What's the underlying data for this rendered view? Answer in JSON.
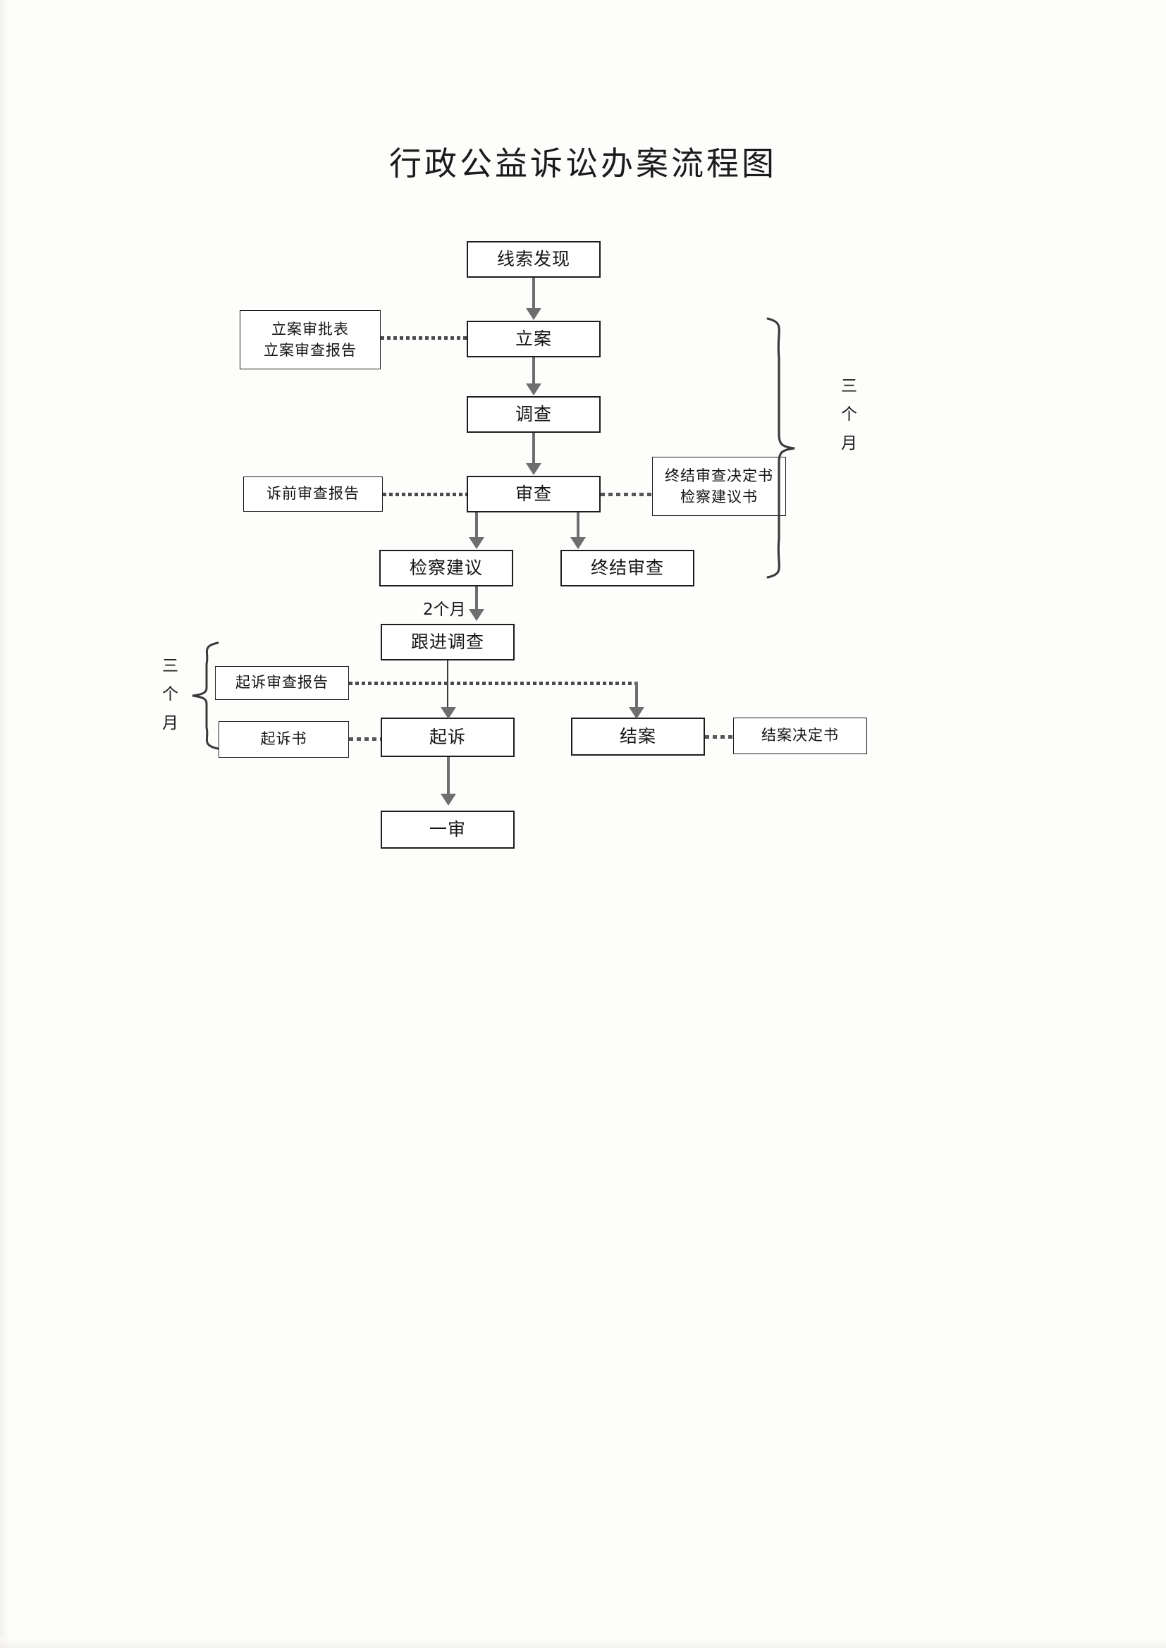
{
  "document": {
    "title": "行政公益诉讼办案流程图",
    "type": "flowchart",
    "language": "zh-CN"
  },
  "nodes": {
    "clue_discovery": {
      "label": "线索发现",
      "kind": "process"
    },
    "case_filing": {
      "label": "立案",
      "kind": "process"
    },
    "filing_docs": {
      "line1": "立案审批表",
      "line2": "立案审查报告",
      "kind": "document"
    },
    "investigation": {
      "label": "调查",
      "kind": "process"
    },
    "review": {
      "label": "审查",
      "kind": "process"
    },
    "pretrial_report": {
      "label": "诉前审查报告",
      "kind": "document"
    },
    "review_docs": {
      "line1": "终结审查决定书",
      "line2": "检察建议书",
      "kind": "document"
    },
    "prosecutorial_suggestion": {
      "label": "检察建议",
      "kind": "process"
    },
    "terminate_review": {
      "label": "终结审查",
      "kind": "process"
    },
    "follow_up_investigation": {
      "label": "跟进调查",
      "kind": "process"
    },
    "prosecution_review_report": {
      "label": "起诉审查报告",
      "kind": "document"
    },
    "indictment": {
      "label": "起诉书",
      "kind": "document"
    },
    "prosecute": {
      "label": "起诉",
      "kind": "process"
    },
    "case_closure": {
      "label": "结案",
      "kind": "process"
    },
    "closure_decision": {
      "label": "结案决定书",
      "kind": "document"
    },
    "first_instance": {
      "label": "一审",
      "kind": "process"
    }
  },
  "edge_labels": {
    "two_months": "2个月"
  },
  "braces": {
    "right": {
      "label_chars": "三\n个\n月",
      "label_line1": "三",
      "label_line2": "个",
      "label_line3": "月"
    },
    "left": {
      "label_chars": "三\n个\n月",
      "label_line1": "三",
      "label_line2": "个",
      "label_line3": "月"
    }
  },
  "colors": {
    "page_background": "#fdfdfc",
    "box_border": "#1d1d1d",
    "arrow": "#6e6e6e",
    "text": "#141414"
  }
}
